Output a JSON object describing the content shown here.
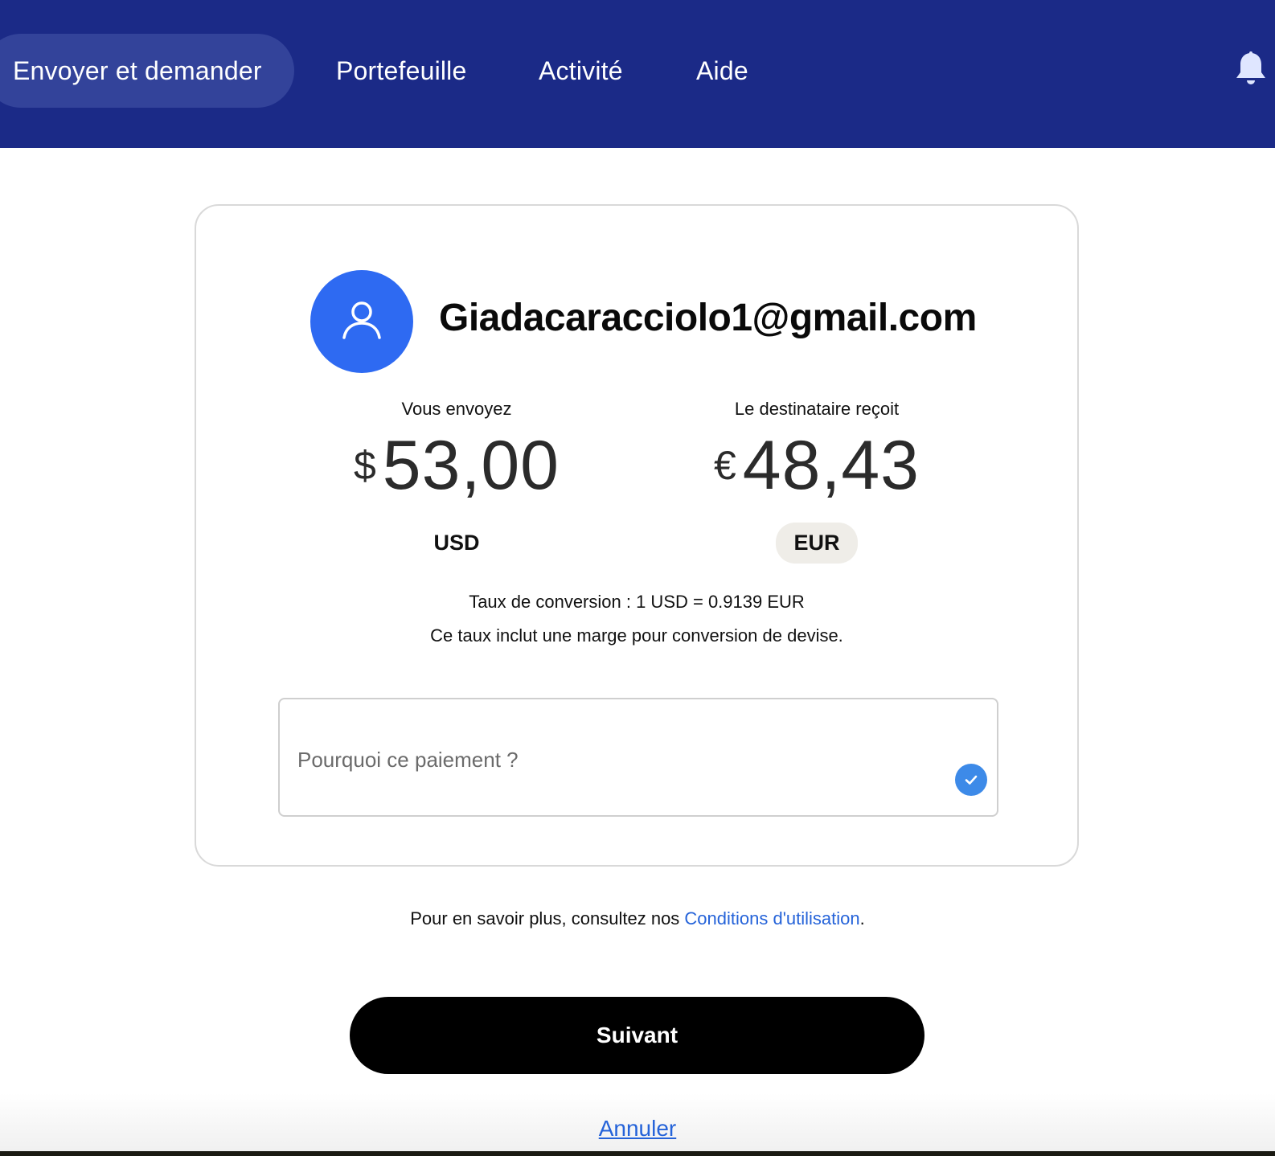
{
  "nav": {
    "items": [
      {
        "label": "Envoyer et demander",
        "active": true
      },
      {
        "label": "Portefeuille"
      },
      {
        "label": "Activité"
      },
      {
        "label": "Aide"
      }
    ],
    "bell_icon": "bell-icon"
  },
  "recipient": {
    "avatar_icon": "user-icon",
    "email": "Giadacaracciolo1@gmail.com"
  },
  "send": {
    "label": "Vous envoyez",
    "symbol": "$",
    "amount": "53,00",
    "currency": "USD"
  },
  "receive": {
    "label": "Le destinataire reçoit",
    "symbol": "€",
    "amount": "48,43",
    "currency": "EUR"
  },
  "conversion": {
    "rate_text": "Taux de conversion : 1 USD = 0.9139 EUR",
    "margin_text": "Ce taux inclut une marge pour conversion de devise."
  },
  "reason": {
    "placeholder": "Pourquoi ce paiement ?",
    "value": ""
  },
  "terms": {
    "prefix": "Pour en savoir plus, consultez nos ",
    "link": "Conditions d'utilisation",
    "suffix": "."
  },
  "actions": {
    "next_label": "Suivant",
    "cancel_label": "Annuler"
  },
  "colors": {
    "nav_bg": "#1b2a87",
    "nav_active_bg": "#33439a",
    "avatar_bg": "#2e6af2",
    "link": "#2563d9",
    "primary_button": "#000000"
  }
}
